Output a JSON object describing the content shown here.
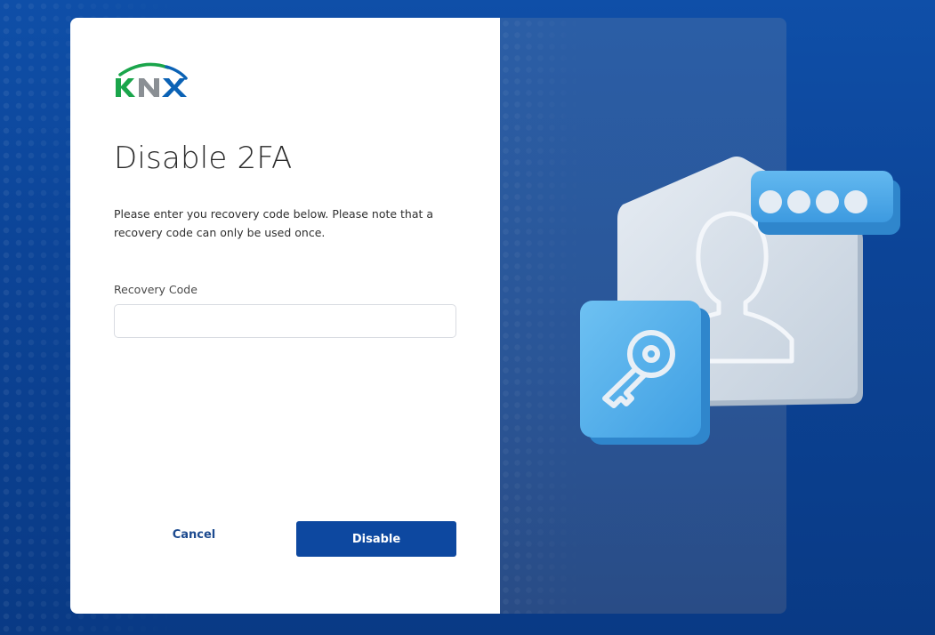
{
  "brand": {
    "logo_text": "KNX",
    "colors": {
      "green": "#1aa54b",
      "gray": "#8a8f94",
      "blue": "#0b62b5"
    }
  },
  "form": {
    "title": "Disable 2FA",
    "description": "Please enter you recovery code below. Please note that a recovery code can only be used once.",
    "recovery_code": {
      "label": "Recovery Code",
      "value": "",
      "placeholder": ""
    },
    "cancel_label": "Cancel",
    "submit_label": "Disable"
  },
  "theme": {
    "primary_button": "#0d48a0",
    "background": "#0c4497",
    "link": "#1c4a8f"
  },
  "illustration": {
    "icons": [
      "user-silhouette-icon",
      "key-icon",
      "password-dots-icon"
    ]
  }
}
